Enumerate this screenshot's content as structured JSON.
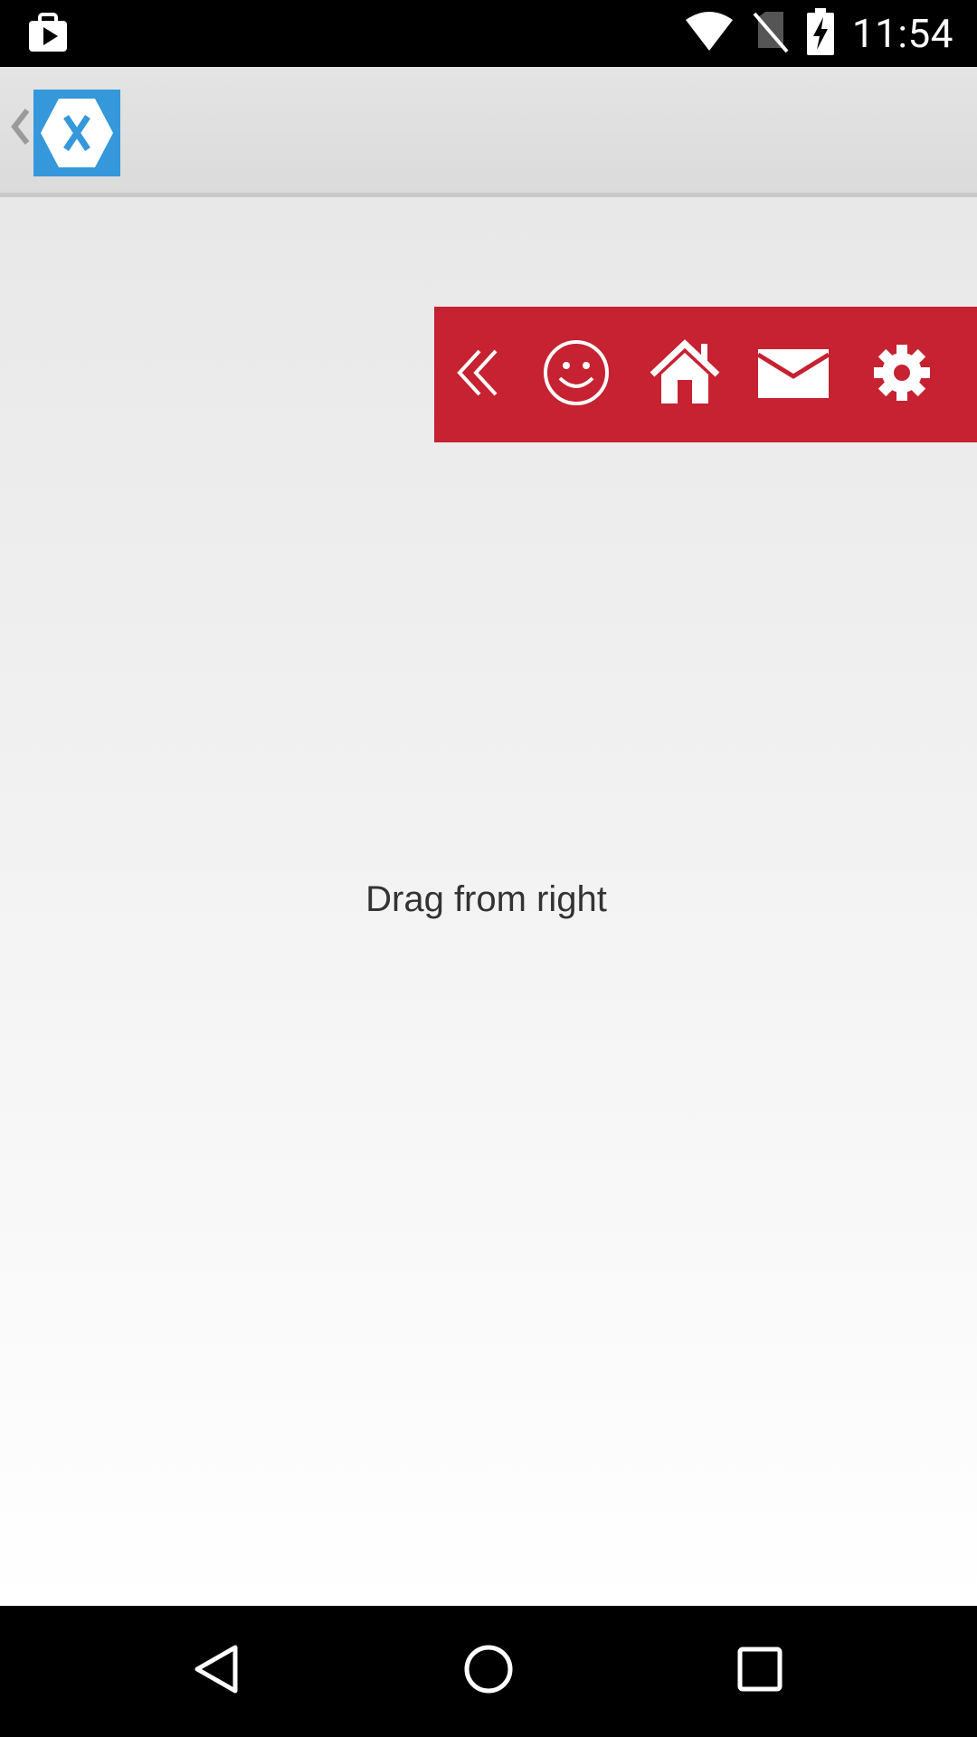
{
  "status_bar": {
    "time": "11:54",
    "icons": [
      "play-store-bag-icon",
      "wifi-icon",
      "no-sim-icon",
      "battery-charging-icon"
    ]
  },
  "action_bar": {
    "back_icon": "chevron-left-icon",
    "logo_icon": "xamarin-logo-icon",
    "logo_color": "#3498db"
  },
  "menu": {
    "background_color": "#c62231",
    "items": [
      {
        "icon": "double-chevron-left-icon"
      },
      {
        "icon": "smiley-icon"
      },
      {
        "icon": "home-icon"
      },
      {
        "icon": "mail-icon"
      },
      {
        "icon": "gear-icon"
      }
    ]
  },
  "content": {
    "label": "Drag from right"
  },
  "nav_bar": {
    "buttons": [
      "back-triangle-icon",
      "home-circle-icon",
      "recents-square-icon"
    ]
  }
}
